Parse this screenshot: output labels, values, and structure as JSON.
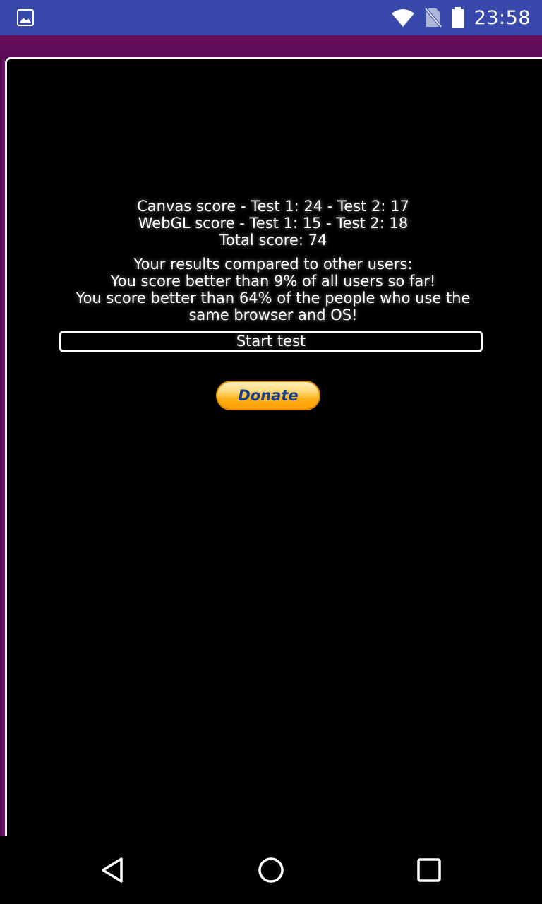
{
  "status_bar": {
    "time": "23:58",
    "icons": [
      "image-icon",
      "wifi-icon",
      "no-sim-icon",
      "battery-icon"
    ]
  },
  "results": {
    "canvas_score": "Canvas score - Test 1: 24 - Test 2: 17",
    "webgl_score": "WebGL score - Test 1: 15 - Test 2: 18",
    "total_score": "Total score: 74",
    "compare_heading": "Your results compared to other users:",
    "compare_all": "You score better than 9% of all users so far!",
    "compare_browser_line1": "You score better than 64% of the people who use the",
    "compare_browser_line2": "same browser and OS!"
  },
  "buttons": {
    "start_test": "Start test",
    "donate": "Donate"
  },
  "nav_bar": {
    "icons": [
      "back-icon",
      "home-icon",
      "recents-icon"
    ]
  },
  "colors": {
    "status_bar": "#3949ab",
    "purple_band": "#6a0f5c",
    "background": "#000000",
    "donate_text": "#153d8a",
    "donate_fill": "#ffb21a"
  }
}
